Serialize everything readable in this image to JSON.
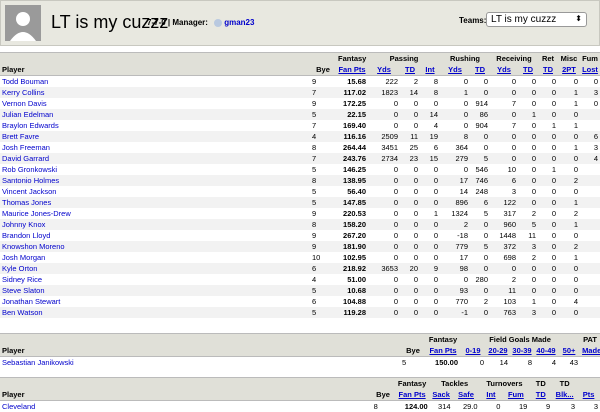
{
  "header": {
    "team_name": "LT is my cuzzz",
    "record": "7-7-0",
    "manager_label": "| Manager:",
    "manager_name": "gman23",
    "teams_label": "Teams:",
    "teams_selected": "LT is my cuzzz"
  },
  "offense": {
    "groups": [
      "Fantasy",
      "Passing",
      "Rushing",
      "Receiving",
      "Ret",
      "Misc",
      "Fum"
    ],
    "columns": [
      "Player",
      "Bye",
      "Fan Pts",
      "Yds",
      "TD",
      "Int",
      "Yds",
      "TD",
      "Yds",
      "TD",
      "TD",
      "2PT",
      "Lost"
    ],
    "rows": [
      {
        "name": "Todd Bouman",
        "bye": "9",
        "pts": "15.68",
        "v": [
          "222",
          "2",
          "8",
          "0",
          "0",
          "0",
          "0",
          "0",
          "0",
          "0"
        ]
      },
      {
        "name": "Kerry Collins",
        "bye": "7",
        "pts": "117.02",
        "v": [
          "1823",
          "14",
          "8",
          "1",
          "0",
          "0",
          "0",
          "0",
          "1",
          "3"
        ]
      },
      {
        "name": "Vernon Davis",
        "bye": "9",
        "pts": "172.25",
        "v": [
          "0",
          "0",
          "0",
          "0",
          "914",
          "7",
          "0",
          "0",
          "1",
          "0"
        ]
      },
      {
        "name": "Julian Edelman",
        "bye": "5",
        "pts": "22.15",
        "v": [
          "0",
          "0",
          "14",
          "0",
          "86",
          "0",
          "1",
          "0",
          "0",
          ""
        ]
      },
      {
        "name": "Braylon Edwards",
        "bye": "7",
        "pts": "169.40",
        "v": [
          "0",
          "0",
          "4",
          "0",
          "904",
          "7",
          "0",
          "1",
          "1",
          ""
        ]
      },
      {
        "name": "Brett Favre",
        "bye": "4",
        "pts": "116.16",
        "v": [
          "2509",
          "11",
          "19",
          "8",
          "0",
          "0",
          "0",
          "0",
          "0",
          "6"
        ]
      },
      {
        "name": "Josh Freeman",
        "bye": "8",
        "pts": "264.44",
        "v": [
          "3451",
          "25",
          "6",
          "364",
          "0",
          "0",
          "0",
          "0",
          "1",
          "3"
        ]
      },
      {
        "name": "David Garrard",
        "bye": "7",
        "pts": "243.76",
        "v": [
          "2734",
          "23",
          "15",
          "279",
          "5",
          "0",
          "0",
          "0",
          "0",
          "4"
        ]
      },
      {
        "name": "Rob Gronkowski",
        "bye": "5",
        "pts": "146.25",
        "v": [
          "0",
          "0",
          "0",
          "0",
          "546",
          "10",
          "0",
          "1",
          "0",
          ""
        ]
      },
      {
        "name": "Santonio Holmes",
        "bye": "8",
        "pts": "138.95",
        "v": [
          "0",
          "0",
          "0",
          "17",
          "746",
          "6",
          "0",
          "0",
          "2",
          ""
        ]
      },
      {
        "name": "Vincent Jackson",
        "bye": "5",
        "pts": "56.40",
        "v": [
          "0",
          "0",
          "0",
          "14",
          "248",
          "3",
          "0",
          "0",
          "0",
          ""
        ]
      },
      {
        "name": "Thomas Jones",
        "bye": "5",
        "pts": "147.85",
        "v": [
          "0",
          "0",
          "0",
          "896",
          "6",
          "122",
          "0",
          "0",
          "1",
          ""
        ]
      },
      {
        "name": "Maurice Jones-Drew",
        "bye": "9",
        "pts": "220.53",
        "v": [
          "0",
          "0",
          "1",
          "1324",
          "5",
          "317",
          "2",
          "0",
          "2",
          ""
        ]
      },
      {
        "name": "Johnny Knox",
        "bye": "8",
        "pts": "158.20",
        "v": [
          "0",
          "0",
          "0",
          "2",
          "0",
          "960",
          "5",
          "0",
          "1",
          ""
        ]
      },
      {
        "name": "Brandon Lloyd",
        "bye": "9",
        "pts": "267.20",
        "v": [
          "0",
          "0",
          "0",
          "-18",
          "0",
          "1448",
          "11",
          "0",
          "0",
          ""
        ]
      },
      {
        "name": "Knowshon Moreno",
        "bye": "9",
        "pts": "181.90",
        "v": [
          "0",
          "0",
          "0",
          "779",
          "5",
          "372",
          "3",
          "0",
          "2",
          ""
        ]
      },
      {
        "name": "Josh Morgan",
        "bye": "10",
        "pts": "102.95",
        "v": [
          "0",
          "0",
          "0",
          "17",
          "0",
          "698",
          "2",
          "0",
          "1",
          ""
        ]
      },
      {
        "name": "Kyle Orton",
        "bye": "6",
        "pts": "218.92",
        "v": [
          "3653",
          "20",
          "9",
          "98",
          "0",
          "0",
          "0",
          "0",
          "0",
          ""
        ]
      },
      {
        "name": "Sidney Rice",
        "bye": "4",
        "pts": "51.00",
        "v": [
          "0",
          "0",
          "0",
          "0",
          "280",
          "2",
          "0",
          "0",
          "0",
          ""
        ]
      },
      {
        "name": "Steve Slaton",
        "bye": "5",
        "pts": "10.68",
        "v": [
          "0",
          "0",
          "0",
          "93",
          "0",
          "11",
          "0",
          "0",
          "0",
          ""
        ]
      },
      {
        "name": "Jonathan Stewart",
        "bye": "6",
        "pts": "104.88",
        "v": [
          "0",
          "0",
          "0",
          "770",
          "2",
          "103",
          "1",
          "0",
          "4",
          ""
        ]
      },
      {
        "name": "Ben Watson",
        "bye": "5",
        "pts": "119.28",
        "v": [
          "0",
          "0",
          "0",
          "-1",
          "0",
          "763",
          "3",
          "0",
          "0",
          ""
        ]
      }
    ]
  },
  "kicker": {
    "groups": [
      "Fantasy",
      "Field Goals Made",
      "PAT"
    ],
    "columns": [
      "Player",
      "Bye",
      "Fan Pts",
      "0-19",
      "20-29",
      "30-39",
      "40-49",
      "50+",
      "Made"
    ],
    "rows": [
      {
        "name": "Sebastian Janikowski",
        "bye": "5",
        "pts": "150.00",
        "v": [
          "0",
          "14",
          "8",
          "4",
          "43"
        ]
      }
    ]
  },
  "defense": {
    "groups": [
      "Fantasy",
      "Tackles",
      "Turnovers",
      "TD",
      "TD"
    ],
    "columns": [
      "Player",
      "Bye",
      "Fan Pts",
      "Sack",
      "Safe",
      "Int",
      "Fum",
      "TD",
      "Blk...",
      "Pts"
    ],
    "rows": [
      {
        "name": "Cleveland",
        "bye": "8",
        "pts": "124.00",
        "v": [
          "314",
          "29.0",
          "0",
          "19",
          "9",
          "3",
          "3",
          "0"
        ]
      }
    ]
  }
}
